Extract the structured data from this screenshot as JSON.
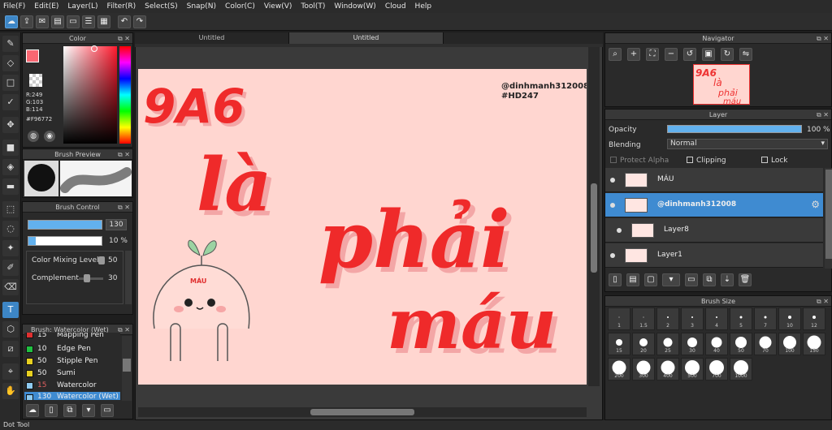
{
  "menu": [
    "File(F)",
    "Edit(E)",
    "Layer(L)",
    "Filter(R)",
    "Select(S)",
    "Snap(N)",
    "Color(C)",
    "View(V)",
    "Tool(T)",
    "Window(W)",
    "Cloud",
    "Help"
  ],
  "tabs": [
    "Untitled",
    "Untitled"
  ],
  "color_panel": {
    "title": "Color",
    "r": "R:249",
    "g": "G:103",
    "b": "B:114",
    "hex": "#F96772",
    "fg": "#F96772",
    "bg": "#F5E3C7"
  },
  "brush_preview": {
    "title": "Brush Preview"
  },
  "brush_control": {
    "title": "Brush Control",
    "size": "130",
    "opacity": "10 %",
    "mixing_label": "Color Mixing Level",
    "mixing_val": "50",
    "complement_label": "Complement",
    "complement_val": "30"
  },
  "brush_list": {
    "title": "Brush: Watercolor (Wet)",
    "items": [
      {
        "num": "15",
        "name": "Mapping Pen",
        "color": "#e03030"
      },
      {
        "num": "10",
        "name": "Edge Pen",
        "color": "#20c040"
      },
      {
        "num": "50",
        "name": "Stipple Pen",
        "color": "#e8d020"
      },
      {
        "num": "50",
        "name": "Sumi",
        "color": "#e8d020"
      },
      {
        "num": "15",
        "name": "Watercolor",
        "color": "#8ecaf0"
      },
      {
        "num": "130",
        "name": "Watercolor (Wet)",
        "color": "#8ecaf0"
      }
    ]
  },
  "art": {
    "handle": "@dinhmanh312008",
    "tag": "#HD247",
    "line1": "9A6",
    "line2": "là",
    "line3": "phải",
    "line4": "máu",
    "mascot_label": "MÁU"
  },
  "navigator": {
    "title": "Navigator"
  },
  "layer": {
    "title": "Layer",
    "opacity_label": "Opacity",
    "opacity_val": "100 %",
    "blending_label": "Blending",
    "blending_val": "Normal",
    "protect": "Protect Alpha",
    "clipping": "Clipping",
    "lock": "Lock",
    "layers": [
      "MÁU",
      "@dinhmanh312008",
      "Layer8",
      "Layer1"
    ]
  },
  "brush_size": {
    "title": "Brush Size",
    "sizes": [
      "1",
      "1.5",
      "2",
      "3",
      "4",
      "5",
      "7",
      "10",
      "12",
      "15",
      "20",
      "25",
      "30",
      "40",
      "50",
      "70",
      "100",
      "150",
      "200",
      "300",
      "400",
      "500",
      "700",
      "1000"
    ]
  },
  "status": "Dot Tool"
}
